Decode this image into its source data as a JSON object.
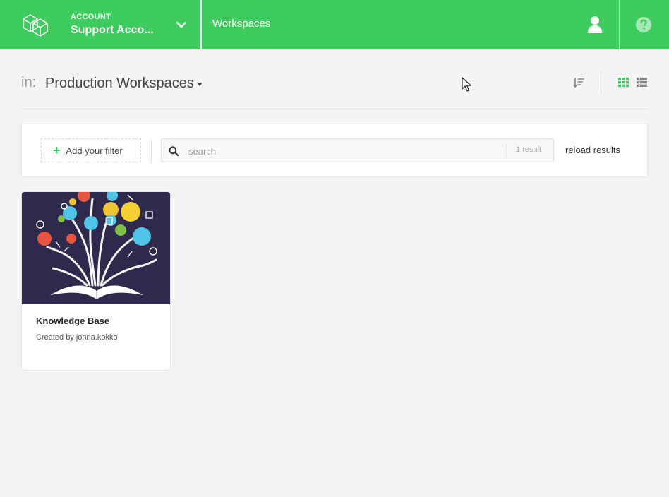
{
  "topbar": {
    "account_kicker": "ACCOUNT",
    "account_name": "Support Acco...",
    "nav_workspaces": "Workspaces"
  },
  "header": {
    "in_label": "in:",
    "folder_name": "Production Workspaces"
  },
  "filters": {
    "add_filter_label": "Add your filter",
    "search_placeholder": "search",
    "search_value": "",
    "result_count": "1 result",
    "reload_label": "reload results"
  },
  "workspaces": [
    {
      "title": "Knowledge Base",
      "created_by": "Created by jonna.kokko"
    }
  ],
  "icons": {
    "logo": "cubes-logo-icon",
    "account_dropdown": "chevron-down-icon",
    "user": "user-icon",
    "help": "help-circle-icon",
    "sort": "sort-icon",
    "grid_view": "grid-view-icon",
    "list_view": "list-view-icon",
    "search": "search-icon",
    "add": "plus-icon"
  },
  "colors": {
    "brand_green": "#3fcc5f",
    "background": "#f4f4f4",
    "card_image_bg": "#2d2a4e",
    "view_active": "#3fcc5f"
  }
}
